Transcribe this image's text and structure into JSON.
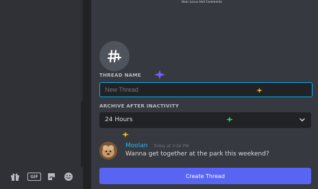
{
  "top_caption": "Hear Locus Hall Comments",
  "form": {
    "thread_name_label": "THREAD NAME",
    "thread_name_placeholder": "New Thread",
    "archive_label": "ARCHIVE AFTER INACTIVITY",
    "archive_value": "24 Hours"
  },
  "message": {
    "author": "Moolan",
    "timestamp": "Today at 3:26 PM",
    "text": "Wanna get together at the park this weekend?"
  },
  "create_button_label": "Create Thread",
  "toolbar": {
    "gift_icon": "gift-icon",
    "gif_label": "GIF",
    "sticker_icon": "sticker-icon",
    "emoji_icon": "emoji-icon"
  },
  "colors": {
    "accent": "#5865f2",
    "focus_border": "#00b0f4",
    "author": "#29b6f6",
    "sparkle_purple": "#7b5cff",
    "sparkle_yellow": "#f0c419",
    "sparkle_green": "#2ecc71"
  }
}
